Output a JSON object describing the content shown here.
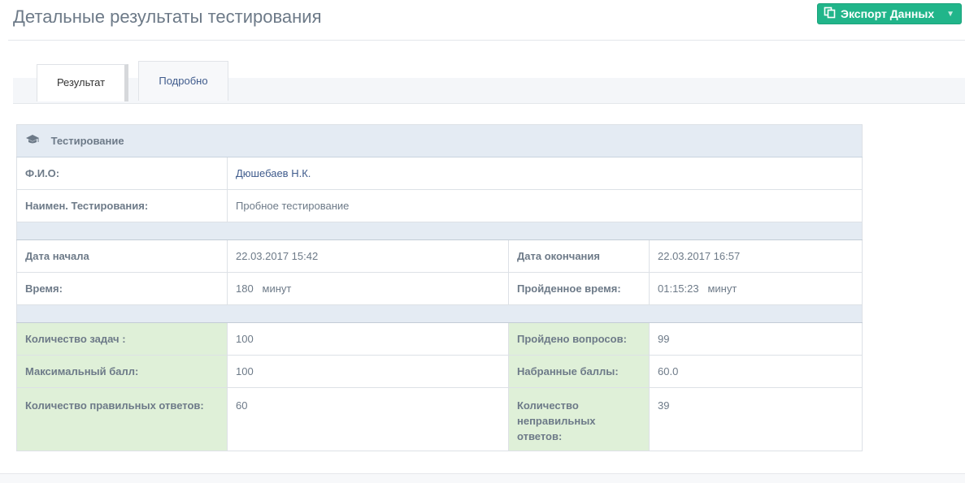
{
  "header": {
    "title": "Детальные результаты тестирования",
    "export_label": "Экспорт Данных",
    "export_icon": "copy-icon",
    "accent_color": "#21b58a"
  },
  "tabs": [
    {
      "label": "Результат",
      "active": true
    },
    {
      "label": "Подробно",
      "active": false
    }
  ],
  "panel": {
    "heading": "Тестирование",
    "heading_icon": "graduation-cap-icon",
    "fio_label": "Ф.И.О:",
    "fio_value": "Дюшебаев Н.К.",
    "test_name_label": "Наимен. Тестирования:",
    "test_name_value": "Пробное тестирование",
    "start_label": "Дата начала",
    "start_value": "22.03.2017 15:42",
    "end_label": "Дата окончания",
    "end_value": "22.03.2017 16:57",
    "time_label": "Время:",
    "time_value": "180   минут",
    "elapsed_label": "Пройденное время:",
    "elapsed_value": "01:15:23   минут",
    "tasks_label": "Количество задач :",
    "tasks_value": "100",
    "answered_label": "Пройдено вопросов:",
    "answered_value": "99",
    "max_score_label": "Максимальный балл:",
    "max_score_value": "100",
    "score_label": "Набранные баллы:",
    "score_value": "60.0",
    "correct_label": "Количество правильных ответов:",
    "correct_value": "60",
    "incorrect_label": "Количество неправильных ответов:",
    "incorrect_value": "39",
    "highlight_color": "#dff0d8"
  }
}
